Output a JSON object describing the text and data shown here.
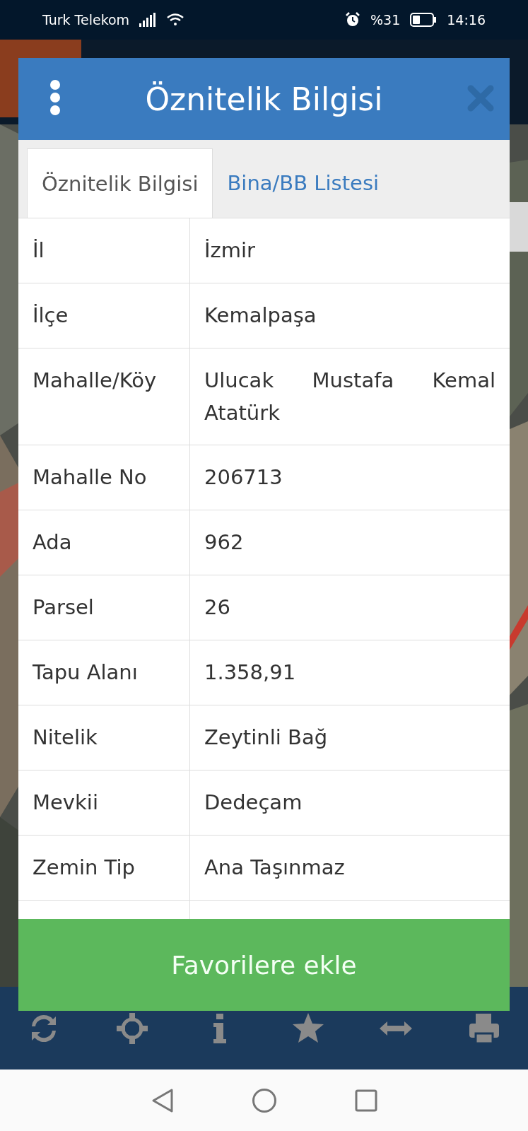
{
  "status_bar": {
    "carrier": "Turk Telekom",
    "battery": "%31",
    "time": "14:16"
  },
  "dialog": {
    "title": "Öznitelik Bilgisi",
    "tabs": [
      {
        "label": "Öznitelik Bilgisi",
        "selected": true
      },
      {
        "label": "Bina/BB Listesi",
        "selected": false
      }
    ],
    "rows": [
      {
        "label": "İl",
        "value": "İzmir"
      },
      {
        "label": "İlçe",
        "value": "Kemalpaşa"
      },
      {
        "label": "Mahalle/Köy",
        "value": "Ulucak Mustafa Kemal Atatürk"
      },
      {
        "label": "Mahalle No",
        "value": "206713"
      },
      {
        "label": "Ada",
        "value": "962"
      },
      {
        "label": "Parsel",
        "value": "26"
      },
      {
        "label": "Tapu Alanı",
        "value": "1.358,91"
      },
      {
        "label": "Nitelik",
        "value": "Zeytinli Bağ"
      },
      {
        "label": "Mevkii",
        "value": "Dedeçam"
      },
      {
        "label": "Zemin Tip",
        "value": "Ana Taşınmaz"
      }
    ],
    "button": "Favorilere ekle"
  }
}
